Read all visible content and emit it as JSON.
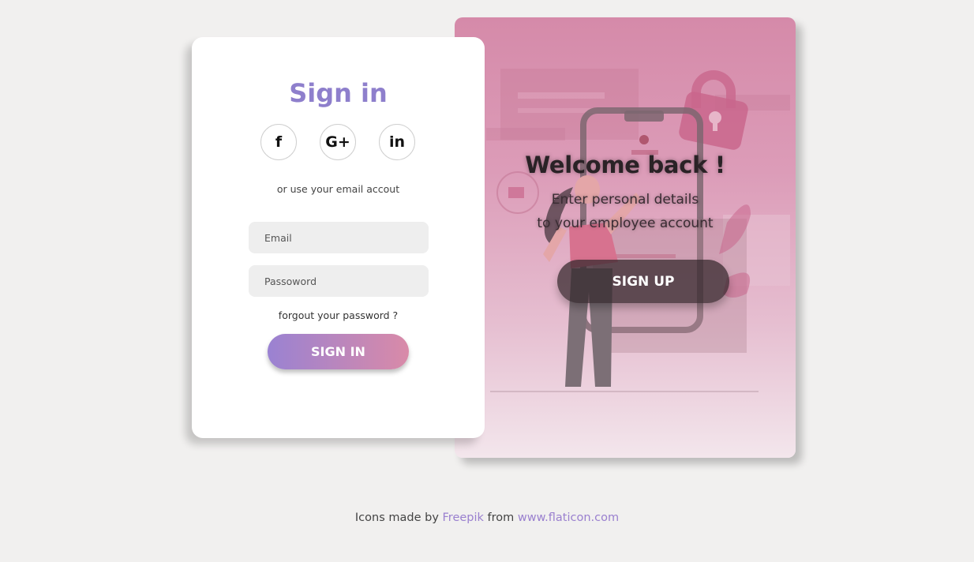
{
  "signin": {
    "title": "Sign in",
    "social": {
      "facebook_label": "f",
      "google_label": "G+",
      "linkedin_label": "in"
    },
    "alt_text": "or use your email accout",
    "email_placeholder": "Email",
    "password_placeholder": "Passoword",
    "forgot_text": "forgout your password ?",
    "button_label": "SIGN IN"
  },
  "signup": {
    "title": "Welcome back !",
    "line1": "Enter personal details",
    "line2": "to your employee account",
    "button_label": "SIGN UP"
  },
  "credits": {
    "prefix": "Icons made by",
    "author": "Freepik",
    "middle": "from",
    "site": "www.flaticon.com"
  },
  "colors": {
    "accent_purple": "#8e7fcc",
    "accent_pink": "#d98aa8",
    "background": "#f1f0ef"
  }
}
